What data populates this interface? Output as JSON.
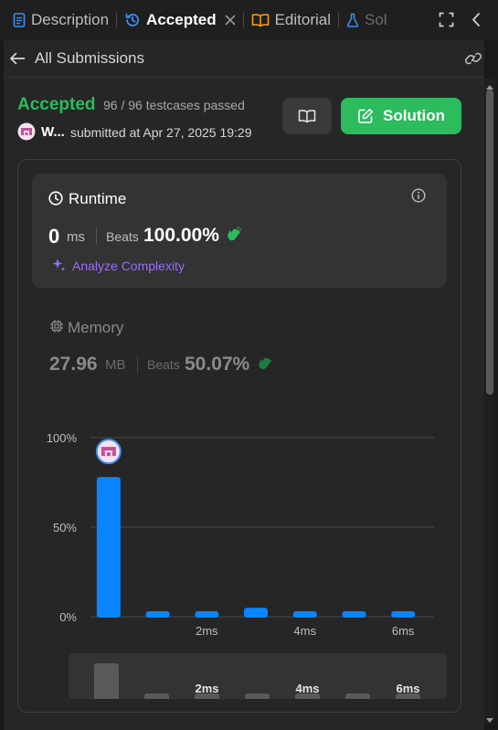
{
  "tabs": [
    {
      "label": "Description",
      "icon": "document-icon"
    },
    {
      "label": "Accepted",
      "icon": "history-icon"
    },
    {
      "label": "Editorial",
      "icon": "book-icon"
    },
    {
      "label": "Sol",
      "icon": "flask-icon"
    }
  ],
  "header": {
    "back_label": "All Submissions"
  },
  "submission": {
    "status": "Accepted",
    "testcases": "96 / 96 testcases passed",
    "user": "W...",
    "submitted_text": "submitted at Apr 27, 2025 19:29",
    "solution_button": "Solution"
  },
  "runtime": {
    "title": "Runtime",
    "value": "0",
    "unit": "ms",
    "beats_label": "Beats",
    "beats_value": "100.00%",
    "analyze_label": "Analyze Complexity"
  },
  "memory": {
    "title": "Memory",
    "value": "27.96",
    "unit": "MB",
    "beats_label": "Beats",
    "beats_value": "50.07%"
  },
  "colors": {
    "accepted": "#2cbb5d",
    "bar": "#0a84ff",
    "analyze": "#9b6dff"
  },
  "chart_data": {
    "type": "bar",
    "title": "",
    "xlabel": "",
    "ylabel": "",
    "ylim": [
      0,
      100
    ],
    "y_ticks": [
      "100%",
      "50%",
      "0%"
    ],
    "x_tick_labels": [
      "2ms",
      "4ms",
      "6ms"
    ],
    "categories": [
      "0ms",
      "1ms",
      "2ms",
      "3ms",
      "4ms",
      "5ms",
      "6ms"
    ],
    "values": [
      78,
      3,
      3,
      5,
      3,
      3,
      3
    ],
    "highlight_index": 0
  },
  "mini_chart": {
    "x_tick_labels": [
      "2ms",
      "4ms",
      "6ms"
    ]
  }
}
